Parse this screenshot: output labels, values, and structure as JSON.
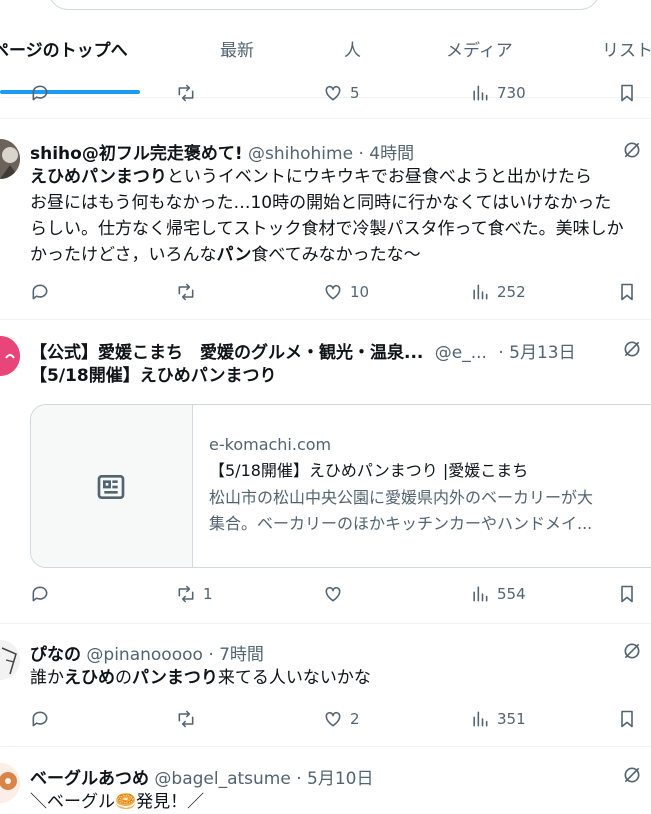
{
  "tabs": [
    {
      "label": "ページのトップへ"
    },
    {
      "label": "最新"
    },
    {
      "label": "人"
    },
    {
      "label": "メディア"
    },
    {
      "label": "リスト"
    }
  ],
  "top_actions": {
    "like_count": "5",
    "view_count": "730"
  },
  "tweets": [
    {
      "name": "shiho@初フル完走褒めて!",
      "handle": "@shihohime",
      "time": "· 4時間",
      "lines": [
        [
          "えひめパンまつり",
          "というイベントにウキウキでお昼食べようと出かけたら"
        ],
        [
          "",
          "お昼にはもう何もなかった…10時の開始と同時に行かなくてはいけなかった"
        ],
        [
          "",
          "らしい。仕方なく帰宅してストック食材で冷製パスタ作って食べた。美味しか"
        ],
        [
          "",
          "かったけどさ，いろんな",
          "パン",
          "食べてみなかったな〜"
        ]
      ],
      "actions": {
        "retweet_count": "",
        "like_count": "10",
        "view_count": "252"
      }
    },
    {
      "name": "【公式】愛媛こまち　愛媛のグルメ・観光・温泉...",
      "handle": "@e_...",
      "time": "· 5月13日",
      "text_bold": "【5/18開催】えひめパンまつり",
      "card": {
        "domain": "e-komachi.com",
        "title": "【5/18開催】えひめパンまつり |愛媛こまち",
        "desc1": "松山市の松山中央公園に愛媛県内外のベーカリーが大",
        "desc2": "集合。ベーカリーのほかキッチンカーやハンドメイ..."
      },
      "actions": {
        "retweet_count": "1",
        "like_count": "",
        "view_count": "554"
      }
    },
    {
      "name": "ぴなの",
      "handle": "@pinanooooo",
      "time": "· 7時間",
      "text_parts": [
        "誰か",
        "えひめ",
        "の",
        "パンまつり",
        "来てる人いないかな"
      ],
      "actions": {
        "retweet_count": "",
        "like_count": "2",
        "view_count": "351"
      }
    },
    {
      "name": "ベーグルあつめ",
      "handle": "@bagel_atsume",
      "time": "· 5月10日",
      "text": "＼ベーグル🥯発見！／"
    }
  ],
  "colors": {
    "accent": "#1d9bf0",
    "muted": "#536471",
    "text": "#0f1419",
    "border": "#eff3f4"
  }
}
